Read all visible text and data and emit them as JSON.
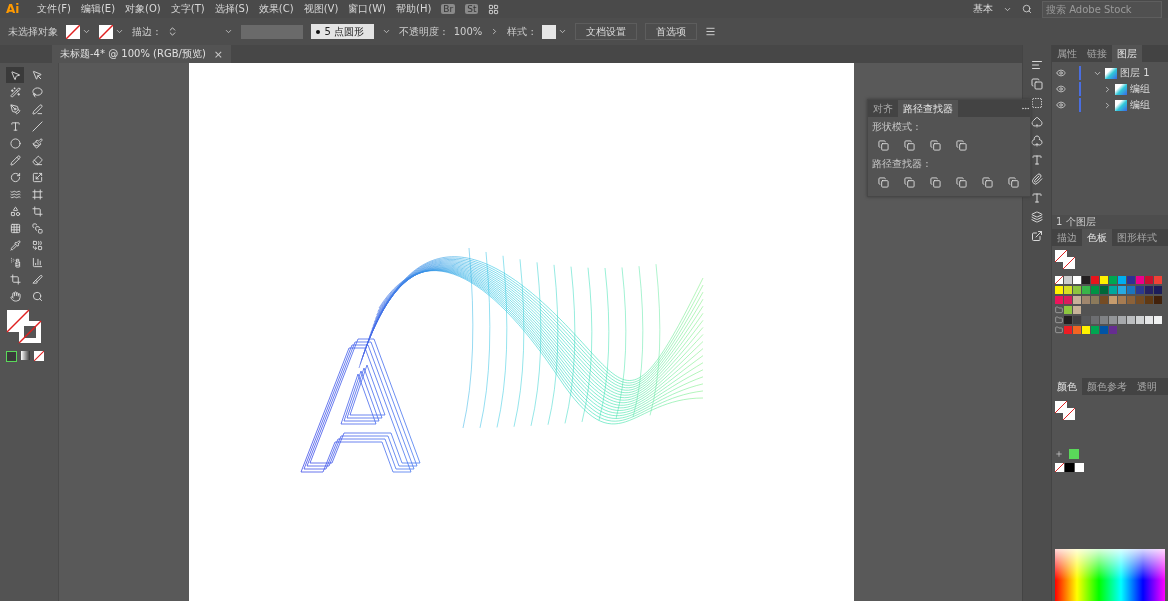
{
  "app": {
    "logo": "Ai"
  },
  "menu": [
    "文件(F)",
    "编辑(E)",
    "对象(O)",
    "文字(T)",
    "选择(S)",
    "效果(C)",
    "视图(V)",
    "窗口(W)",
    "帮助(H)"
  ],
  "app_buttons": [
    "Br",
    "St"
  ],
  "workspace": "基本",
  "search": {
    "placeholder": "搜索 Adobe Stock"
  },
  "control_bar": {
    "selection": "未选择对象",
    "stroke_label": "描边 :",
    "brush": "5 点圆形",
    "opacity_label": "不透明度 :",
    "opacity": "100%",
    "style_label": "样式 :",
    "buttons": [
      "文档设置",
      "首选项"
    ]
  },
  "document_tabs": [
    {
      "title": "未标题-4* @ 100% (RGB/预览)",
      "close": "×",
      "selected": true
    }
  ],
  "pathfinder_panel": {
    "tabs": [
      {
        "label": "对齐",
        "selected": false
      },
      {
        "label": "路径查找器",
        "selected": true
      }
    ],
    "sections": [
      {
        "label": "形状模式 :"
      },
      {
        "label": "路径查找器 :"
      }
    ]
  },
  "layers_panel": {
    "tabs": [
      {
        "label": "属性",
        "selected": false
      },
      {
        "label": "链接",
        "selected": false
      },
      {
        "label": "图层",
        "selected": true
      }
    ],
    "layers": [
      {
        "name": "图层 1",
        "expanded": true,
        "children": [
          {
            "name": "编组",
            "expanded": false
          },
          {
            "name": "编组",
            "expanded": false
          }
        ]
      }
    ],
    "footer": "1 个图层"
  },
  "swatches_panel": {
    "tabs": [
      {
        "label": "描边",
        "selected": false
      },
      {
        "label": "色板",
        "selected": true
      },
      {
        "label": "图形样式",
        "selected": false
      }
    ],
    "rows": [
      [
        {
          "color": "#cccccc"
        },
        {
          "color": "#ffffff"
        },
        {
          "color": "#231f20"
        },
        {
          "color": "#e8141c"
        },
        {
          "color": "#fff100"
        },
        {
          "color": "#00a651"
        },
        {
          "color": "#00aeef"
        },
        {
          "color": "#2e3192"
        },
        {
          "color": "#ec008c"
        },
        {
          "color": "#c8102e"
        },
        {
          "color": "#ef4136"
        }
      ],
      [
        {
          "color": "#fff200"
        },
        {
          "color": "#d7df23"
        },
        {
          "color": "#8dc63f"
        },
        {
          "color": "#39b54a"
        },
        {
          "color": "#009444"
        },
        {
          "color": "#006838"
        },
        {
          "color": "#00a99d"
        },
        {
          "color": "#27aae1"
        },
        {
          "color": "#1b75bc"
        },
        {
          "color": "#2b3990"
        },
        {
          "color": "#262262"
        },
        {
          "color": "#1c1c5a"
        }
      ],
      [
        {
          "color": "#ed145b"
        },
        {
          "color": "#d91c5c"
        },
        {
          "color": "#c7b299"
        },
        {
          "color": "#a0876e"
        },
        {
          "color": "#8c7a5b"
        },
        {
          "color": "#754c24"
        },
        {
          "color": "#c69c6d"
        },
        {
          "color": "#a67c52"
        },
        {
          "color": "#8c6239"
        },
        {
          "color": "#754c24"
        },
        {
          "color": "#603913"
        },
        {
          "color": "#42210b"
        }
      ],
      [
        {
          "color": "#8dc63f"
        },
        {
          "color": "#c7b299"
        }
      ],
      [
        {
          "color": "#231f20"
        },
        {
          "color": "#414042"
        },
        {
          "color": "#58595b"
        },
        {
          "color": "#6d6e71"
        },
        {
          "color": "#808285"
        },
        {
          "color": "#939598"
        },
        {
          "color": "#a7a9ac"
        },
        {
          "color": "#bcbec0"
        },
        {
          "color": "#d1d3d4"
        },
        {
          "color": "#e6e7e8"
        },
        {
          "color": "#f1f2f2"
        }
      ],
      [
        {
          "color": "#ed1c24"
        },
        {
          "color": "#f26522"
        },
        {
          "color": "#fff200"
        },
        {
          "color": "#00a651"
        },
        {
          "color": "#0054a6"
        },
        {
          "color": "#662d91"
        }
      ]
    ]
  },
  "color_panel": {
    "tabs": [
      {
        "label": "颜色",
        "selected": true
      },
      {
        "label": "颜色参考",
        "selected": false
      },
      {
        "label": "透明",
        "selected": false
      }
    ],
    "quick_swatches": [
      {
        "color": "#5ad85a"
      }
    ],
    "basic_swatches": [
      {
        "color": "#000000"
      },
      {
        "color": "#ffffff"
      }
    ]
  }
}
